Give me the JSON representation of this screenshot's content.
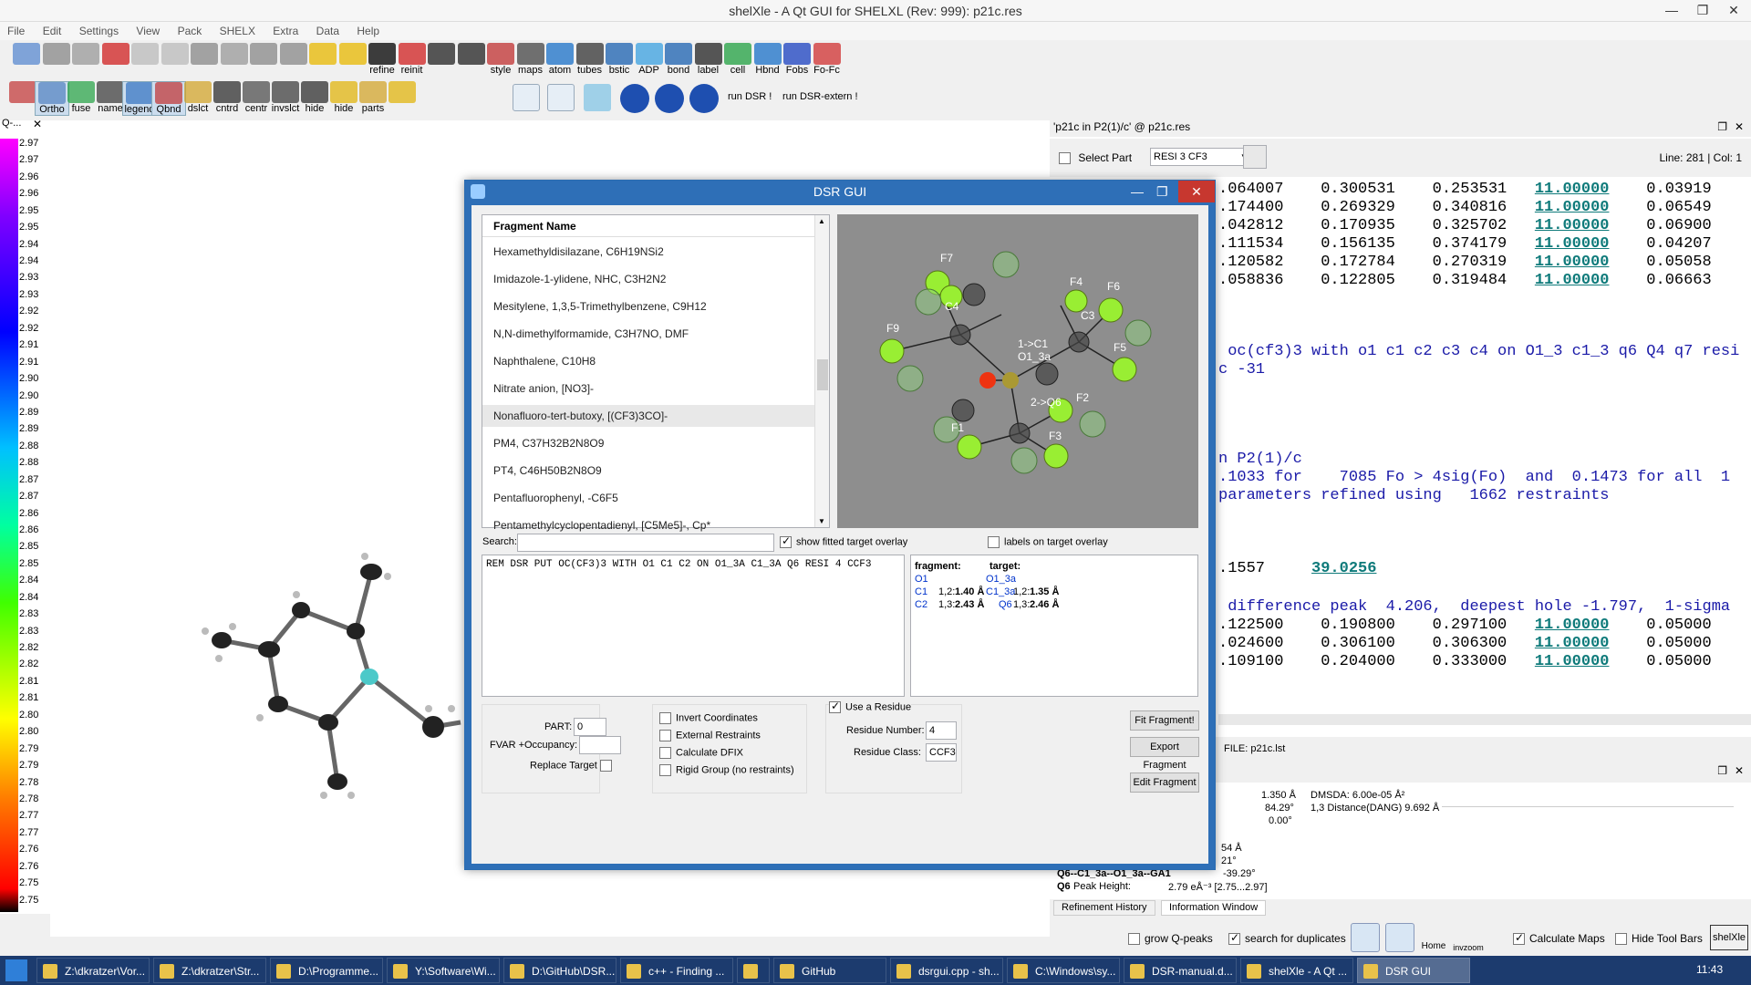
{
  "window": {
    "title": "shelXle - A Qt GUI for SHELXL (Rev: 999): p21c.res",
    "controls": [
      "—",
      "❐",
      "✕"
    ]
  },
  "menu": [
    "File",
    "Edit",
    "Settings",
    "View",
    "Pack",
    "SHELX",
    "Extra",
    "Data",
    "Help"
  ],
  "toolbar1": [
    {
      "name": "fcf",
      "label": ""
    },
    {
      "name": "img",
      "label": ""
    },
    {
      "name": "save",
      "label": ""
    },
    {
      "name": "stop",
      "label": ""
    },
    {
      "name": "undo",
      "label": ""
    },
    {
      "name": "redo",
      "label": ""
    },
    {
      "name": "cut",
      "label": ""
    },
    {
      "name": "copy",
      "label": ""
    },
    {
      "name": "paste",
      "label": ""
    },
    {
      "name": "find",
      "label": ""
    },
    {
      "name": "skull1",
      "label": ""
    },
    {
      "name": "skull2",
      "label": ""
    },
    {
      "name": "refine",
      "label": "refine"
    },
    {
      "name": "reinit",
      "label": "reinit"
    },
    {
      "name": "font-up",
      "label": ""
    },
    {
      "name": "font-down",
      "label": ""
    },
    {
      "name": "style",
      "label": "style"
    },
    {
      "name": "maps",
      "label": "maps"
    },
    {
      "name": "atom",
      "label": "atom"
    },
    {
      "name": "tubes",
      "label": "tubes"
    },
    {
      "name": "bstic",
      "label": "bstic"
    },
    {
      "name": "adp",
      "label": "ADP"
    },
    {
      "name": "bond",
      "label": "bond"
    },
    {
      "name": "label",
      "label": "label"
    },
    {
      "name": "cell",
      "label": "cell"
    },
    {
      "name": "hbnd",
      "label": "Hbnd"
    },
    {
      "name": "fobs",
      "label": "Fobs"
    },
    {
      "name": "fofc",
      "label": "Fo-Fc"
    }
  ],
  "toolbar2": [
    {
      "name": "grid",
      "label": ""
    },
    {
      "name": "ortho",
      "label": "Ortho"
    },
    {
      "name": "fuse",
      "label": "fuse"
    },
    {
      "name": "name",
      "label": "name"
    },
    {
      "name": "qpeak",
      "label": "legend"
    },
    {
      "name": "qbnd",
      "label": "Qbnd"
    },
    {
      "name": "dslct",
      "label": "dslct"
    },
    {
      "name": "cntrd",
      "label": "cntrd"
    },
    {
      "name": "centr",
      "label": "centr"
    },
    {
      "name": "invslct",
      "label": "invslct"
    },
    {
      "name": "hide1",
      "label": "hide"
    },
    {
      "name": "hide2",
      "label": "hide"
    },
    {
      "name": "parts",
      "label": "parts"
    },
    {
      "name": "skull",
      "label": ""
    }
  ],
  "toolbar2_text": {
    "run_dsr": "run DSR !",
    "run_dsr_extern": "run DSR-extern !"
  },
  "qpeak_panel": {
    "header": "Q-...",
    "ticks": [
      "2.97",
      "2.97",
      "2.96",
      "2.96",
      "2.95",
      "2.95",
      "2.94",
      "2.94",
      "2.93",
      "2.93",
      "2.92",
      "2.92",
      "2.91",
      "2.91",
      "2.90",
      "2.90",
      "2.89",
      "2.89",
      "2.88",
      "2.88",
      "2.87",
      "2.87",
      "2.86",
      "2.86",
      "2.85",
      "2.85",
      "2.84",
      "2.84",
      "2.83",
      "2.83",
      "2.82",
      "2.82",
      "2.81",
      "2.81",
      "2.80",
      "2.80",
      "2.79",
      "2.79",
      "2.78",
      "2.78",
      "2.77",
      "2.77",
      "2.76",
      "2.76",
      "2.75",
      "2.75"
    ]
  },
  "editor": {
    "tab_title": "'p21c in P2(1)/c' @ p21c.res",
    "select_part_label": "Select Part",
    "resi_select": "RESI 3 CF3",
    "line_col": "Line: 281 | Col: 1",
    "lines": [
      {
        "t": ".064007    0.300531    0.253531   ",
        "u": "11.00000",
        "e": "    0.03919"
      },
      {
        "t": ".174400    0.269329    0.340816   ",
        "u": "11.00000",
        "e": "    0.06549"
      },
      {
        "t": ".042812    0.170935    0.325702   ",
        "u": "11.00000",
        "e": "    0.06900"
      },
      {
        "t": ".111534    0.156135    0.374179   ",
        "u": "11.00000",
        "e": "    0.04207"
      },
      {
        "t": ".120582    0.172784    0.270319   ",
        "u": "11.00000",
        "e": "    0.05058"
      },
      {
        "t": ".058836    0.122805    0.319484   ",
        "u": "11.00000",
        "e": "    0.06663"
      }
    ],
    "blue_lines": [
      " oc(cf3)3 with o1 c1 c2 c3 c4 on O1_3 c1_3 q6 Q4 q7 resi",
      "c -31",
      "",
      "",
      "",
      "n P2(1)/c",
      ".1033 for    7085 Fo > 4sig(Fo)  and  0.1473 for all  1",
      "parameters refined using   1662 restraints"
    ],
    "line_1557": ".1557     ",
    "line_1557_val": "39.0256",
    "diff_peak": " difference peak  4.206,  deepest hole -1.797,  1-sigma",
    "lines2": [
      {
        "t": ".122500    0.190800    0.297100   ",
        "u": "11.00000",
        "e": "    0.05000"
      },
      {
        "t": ".024600    0.306100    0.306300   ",
        "u": "11.00000",
        "e": "    0.05000"
      },
      {
        "t": ".109100    0.204000    0.333000   ",
        "u": "11.00000",
        "e": "    0.05000"
      }
    ],
    "file_label": "FILE: p21c.lst"
  },
  "info": {
    "row1": [
      "1.350 Å",
      "DMSDA: 6.00e-05 Å²"
    ],
    "row2": [
      "84.29°",
      "1,3 Distance(DANG)  9.692 Å"
    ],
    "row3": "0.00°",
    "row4": "54 Å",
    "row5": "21°",
    "row6_label": "Q6--C1_3a--O1_3a--GA1",
    "row6_val": "-39.29°",
    "row7_label": "Q6",
    "row7_text": "Peak Height:",
    "row7_val": "2.79 eÅ⁻³ [2.75...2.97]",
    "tabs": [
      "Refinement History",
      "Information Window"
    ]
  },
  "statusbar": {
    "grow_q": "grow Q-peaks",
    "search_dup": "search for duplicates",
    "home": "Home",
    "invzoom": "invzoom",
    "calc_maps": "Calculate Maps",
    "hide_tool": "Hide Tool Bars",
    "shelxle": "shelXle"
  },
  "dialog": {
    "title": "DSR GUI",
    "header": "Fragment Name",
    "fragments": [
      "Hexamethyldisilazane, C6H19NSi2",
      "Imidazole-1-ylidene, NHC, C3H2N2",
      "Mesitylene, 1,3,5-Trimethylbenzene, C9H12",
      "N,N-dimethylformamide, C3H7NO, DMF",
      "Naphthalene, C10H8",
      "Nitrate anion, [NO3]-",
      "Nonafluoro-tert-butoxy, [(CF3)3CO]-",
      "PM4, C37H32B2N8O9",
      "PT4, C46H50B2N8O9",
      "Pentafluorophenyl, -C6F5",
      "Pentamethylcyclopentadienyl, [C5Me5]-, Cp*"
    ],
    "selected_index": 6,
    "search_label": "Search:",
    "show_overlay": "show fitted target overlay",
    "labels_overlay": "labels on target overlay",
    "command": "REM DSR PUT OC(CF3)3 WITH O1 C1 C2 ON O1_3A C1_3A Q6 RESI 4 CCF3",
    "fit_table": {
      "h_fragment": "fragment:",
      "h_target": "target:",
      "rows": [
        {
          "f": "O1",
          "d": "",
          "t": "O1_3a",
          "v": ""
        },
        {
          "f": "C1",
          "d": "1,2:",
          "dv": "1.40 Å",
          "t": "C1_3a",
          "d2": "1,2:",
          "v": "1.35 Å"
        },
        {
          "f": "C2",
          "d": "1,3:",
          "dv": "2.43 Å",
          "t": "Q6",
          "d2": "1,3:",
          "v": "2.46 Å"
        }
      ]
    },
    "part_label": "PART:",
    "part_value": "0",
    "fvar_label": "FVAR +Occupancy:",
    "replace_target": "Replace Target",
    "invert_coords": "Invert Coordinates",
    "external_restraints": "External Restraints",
    "calc_dfix": "Calculate DFIX",
    "rigid_group": "Rigid Group (no restraints)",
    "use_residue": "Use a Residue",
    "residue_number_label": "Residue Number:",
    "residue_number": "4",
    "residue_class_label": "Residue Class:",
    "residue_class": "CCF3",
    "fit_fragment": "Fit Fragment!",
    "export_fragment": "Export Fragment",
    "edit_fragment": "Edit Fragment",
    "molecule_labels": [
      "F7",
      "F4",
      "F6",
      "C4",
      "C3",
      "F9",
      "1->C1",
      "O1_3a",
      "F5",
      "2->Q6",
      "F2",
      "F1",
      "F3"
    ]
  },
  "taskbar": {
    "items": [
      "Z:\\dkratzer\\Vor...",
      "Z:\\dkratzer\\Str...",
      "D:\\Programme...",
      "Y:\\Software\\Wi...",
      "D:\\GitHub\\DSR...",
      "c++ - Finding ...",
      "",
      "GitHub",
      "dsrgui.cpp - sh...",
      "C:\\Windows\\sy...",
      "DSR-manual.d...",
      "shelXle - A Qt ...",
      "DSR GUI"
    ],
    "clock": "11:43"
  }
}
